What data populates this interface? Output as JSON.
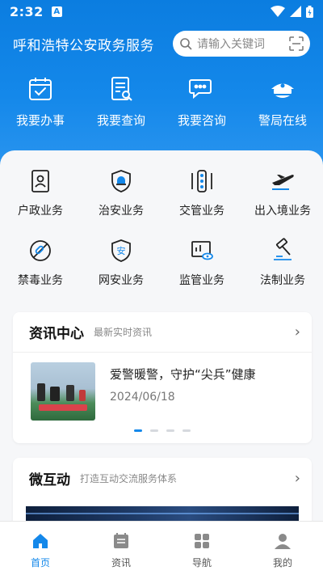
{
  "status_bar": {
    "time": "2:32",
    "notification_letter": "A"
  },
  "header": {
    "title": "呼和浩特公安政务服务",
    "search_placeholder": "请输入关键词"
  },
  "quick_actions": [
    {
      "label": "我要办事",
      "icon": "calendar-check-icon"
    },
    {
      "label": "我要查询",
      "icon": "document-search-icon"
    },
    {
      "label": "我要咨询",
      "icon": "chat-bubbles-icon"
    },
    {
      "label": "警局在线",
      "icon": "police-cap-icon"
    }
  ],
  "services": [
    {
      "label": "户政业务",
      "icon": "id-card-icon"
    },
    {
      "label": "治安业务",
      "icon": "shield-alarm-icon"
    },
    {
      "label": "交管业务",
      "icon": "traffic-light-icon"
    },
    {
      "label": "出入境业务",
      "icon": "airplane-icon"
    },
    {
      "label": "禁毒业务",
      "icon": "no-drugs-icon"
    },
    {
      "label": "网安业务",
      "icon": "cyber-shield-icon"
    },
    {
      "label": "监管业务",
      "icon": "monitor-eye-icon"
    },
    {
      "label": "法制业务",
      "icon": "gavel-icon"
    }
  ],
  "news": {
    "title": "资讯中心",
    "subtitle": "最新实时资讯",
    "item": {
      "title": "爱警暖警，守护“尖兵”健康",
      "date": "2024/06/18"
    },
    "carousel_pages": 4,
    "carousel_active": 1
  },
  "micro": {
    "title": "微互动",
    "subtitle": "打造互动交流服务体系"
  },
  "tabbar": [
    {
      "label": "首页",
      "icon": "home-icon",
      "active": true
    },
    {
      "label": "资讯",
      "icon": "news-icon",
      "active": false
    },
    {
      "label": "导航",
      "icon": "grid-icon",
      "active": false
    },
    {
      "label": "我的",
      "icon": "user-icon",
      "active": false
    }
  ],
  "colors": {
    "primary": "#1488ea",
    "hero_top": "#0b7de0",
    "background": "#f1f3f6"
  }
}
